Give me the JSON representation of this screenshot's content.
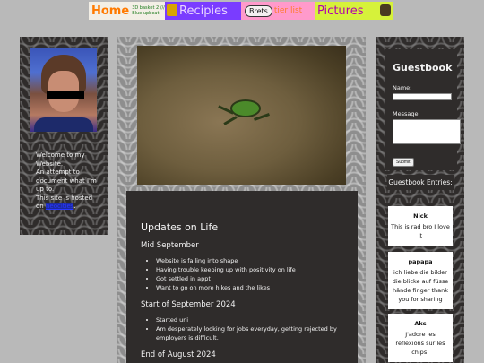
{
  "nav": {
    "home": {
      "label": "Home",
      "small": "3D basket 2 /// Blue upbeat"
    },
    "recipes": {
      "label": "Recipies"
    },
    "brets": {
      "pill": "Brets",
      "label": "tier list"
    },
    "pictures": {
      "label": "Pictures"
    }
  },
  "left": {
    "welcome_lines": [
      "Welcome to my Website.",
      "An attempt to document what I'm up to.",
      "This site is hosted on"
    ],
    "link_text": "neocities",
    "link_suffix": "."
  },
  "updates": {
    "title": "Updates on Life",
    "sections": [
      {
        "heading": "Mid September",
        "items": [
          "Website is falling into shape",
          "Having trouble keeping up with positivity on life",
          "Got settled in appt",
          "Want to go on more hikes and the likes"
        ]
      },
      {
        "heading": "Start of September 2024",
        "items": [
          "Started uni",
          "Am desperately looking for jobs everyday, getting rejected by employers is difficult."
        ]
      },
      {
        "heading": "End of August 2024",
        "items": []
      }
    ]
  },
  "guestbook": {
    "title": "Guestbook",
    "name_label": "Name:",
    "message_label": "Message:",
    "submit_label": "Submit",
    "entries_heading": "Guestbook Entries:",
    "entries": [
      {
        "name": "Nick",
        "message": "This is rad bro I love it"
      },
      {
        "name": "papapa",
        "message": "ich liebe die bilder die blicke auf füsse hände finger thank you for sharing"
      },
      {
        "name": "Aks",
        "message": "J'adore les réflexions sur les chips!"
      }
    ]
  }
}
